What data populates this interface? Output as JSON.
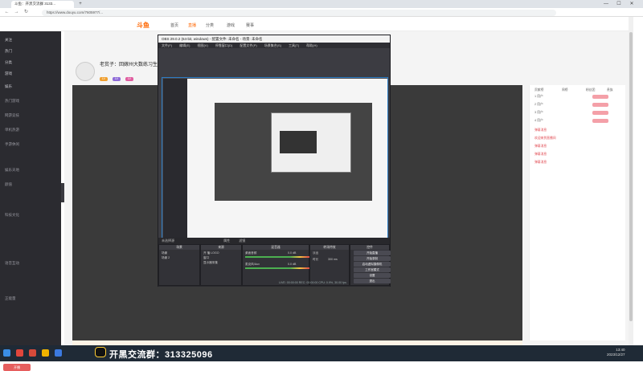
{
  "browser": {
    "tab_title": "斗鱼：开黑交流群 3133...",
    "url": "https://www.douyu.com/7605977/...",
    "back": "←",
    "forward": "→",
    "refresh": "↻",
    "new_tab": "+",
    "minimize": "—",
    "maximize": "☐",
    "close": "✕"
  },
  "site": {
    "logo": "斗鱼",
    "nav": [
      "首页",
      "直播",
      "分类",
      "游戏",
      "赛事"
    ],
    "room_title": "老贫子：回嫁州大数练习生",
    "tags": [
      "LV",
      "LV",
      "LV"
    ]
  },
  "sidebar": {
    "items": [
      "关注",
      "热门",
      "分类",
      "游戏",
      "娱乐",
      "热门游戏",
      "网游竞技",
      "单机热游",
      "手游休闲",
      "娱乐天地",
      "颜值",
      "科技文化",
      "语音互动",
      "正能量"
    ],
    "button": "开播"
  },
  "right_panel": {
    "rows": [
      "贡献榜",
      "周榜",
      "粉丝团",
      "贵族",
      "1 用户",
      "2 用户",
      "3 用户",
      "4 用户",
      "弹幕消息",
      "欢迎来到直播间",
      "弹幕消息",
      "弹幕消息",
      "弹幕消息"
    ]
  },
  "obs": {
    "title": "OBS 29.0.2 (64-bit, windows) - 配置文件: 未命名 - 场景: 未命名",
    "menu": [
      "文件(F)",
      "编辑(E)",
      "视图(V)",
      "停靠窗口(D)",
      "配置文件(P)",
      "场景集合(S)",
      "工具(T)",
      "帮助(H)"
    ],
    "control_bar": "未选择源",
    "properties": "属性",
    "filters": "滤镜",
    "docks": {
      "scenes": {
        "title": "场景",
        "items": [
          "场景",
          "场景 2"
        ]
      },
      "sources": {
        "title": "来源",
        "items": [
          "开 播 LOGO",
          "窗口",
          "显示器采集"
        ]
      },
      "mixer": {
        "title": "混音器",
        "items": [
          "桌面音频",
          "麦克风/Aux"
        ],
        "levels": [
          "0.0 dB",
          "0.0 dB"
        ]
      },
      "transitions": {
        "title": "转场特效",
        "items": [
          "淡出",
          "时长"
        ],
        "duration": "300 ms"
      },
      "controls": {
        "title": "控件",
        "buttons": [
          "开始直播",
          "开始录制",
          "启动虚拟摄像机",
          "工作室模式",
          "设置",
          "退出"
        ]
      }
    },
    "status": "LIVE: 00:00:00   REC: 00:00:00   CPU: 0.9%, 30.00 fps"
  },
  "nested_taskbar": "开黑交流群：313325096",
  "taskbar": {
    "banner": "开黑交流群：313325096",
    "time": "13:40",
    "date": "2023/12/27"
  },
  "colors": {
    "sidebar": "#2b2b30",
    "obs_bg": "#2e2e33",
    "accent": "#f60",
    "selection": "#2c7cc4"
  }
}
